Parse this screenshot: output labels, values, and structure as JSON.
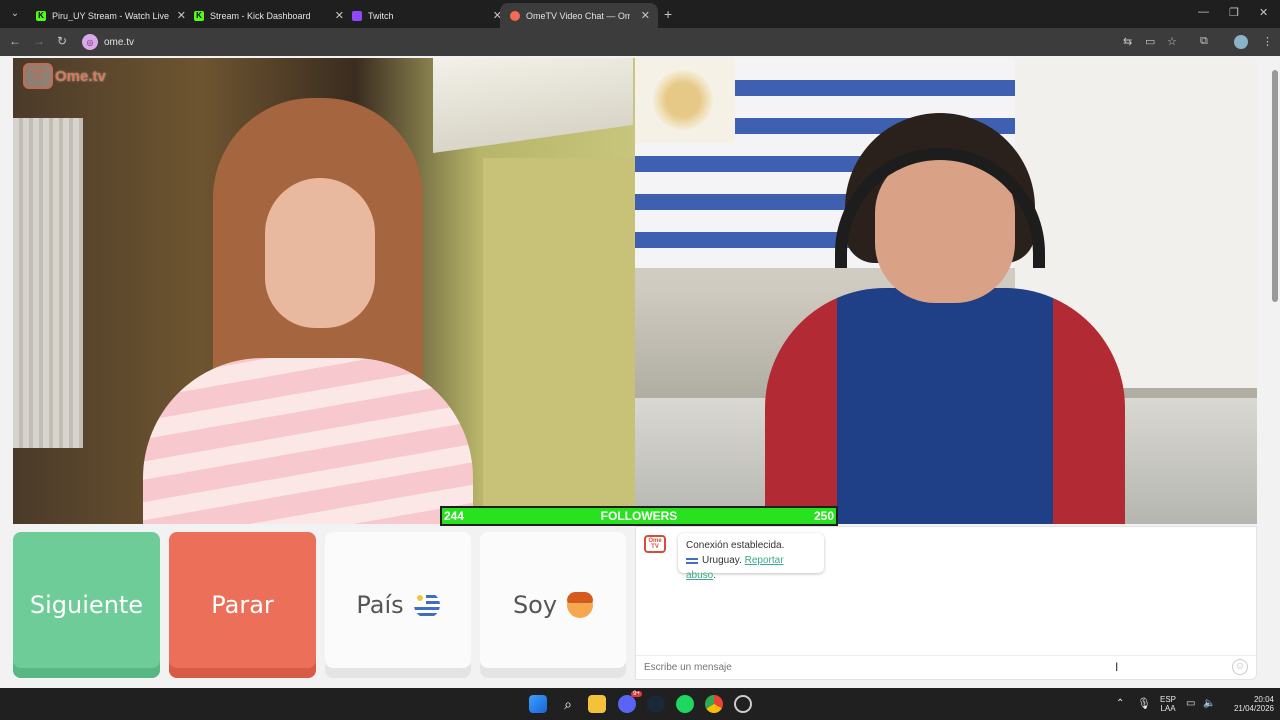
{
  "browser": {
    "tabs": [
      {
        "title": "Piru_UY Stream - Watch Live on",
        "fav_color": "#53fc18",
        "fav_text": "K"
      },
      {
        "title": "Stream - Kick Dashboard",
        "fav_color": "#53fc18",
        "fav_text": "K"
      },
      {
        "title": "Twitch",
        "fav_color": "#9146ff",
        "fav_text": ""
      },
      {
        "title": "OmeTV Video Chat — Ome",
        "fav_color": "#f26b55",
        "fav_text": ""
      }
    ],
    "url": "ome.tv"
  },
  "logo": {
    "box_top": "Ome",
    "box_bottom": "TV",
    "text": "Ome.tv"
  },
  "followers": {
    "left_count": "244",
    "label": "FOLLOWERS",
    "right_count": "250"
  },
  "controls": {
    "next_label": "Siguiente",
    "stop_label": "Parar",
    "country_label": "País",
    "gender_label": "Soy"
  },
  "chat": {
    "status": "Conexión establecida.",
    "country": "Uruguay.",
    "report_link": "Reportar abuso",
    "report_suffix": ".",
    "input_placeholder": "Escribe un mensaje"
  },
  "taskbar": {
    "lang_top": "ESP",
    "lang_bottom": "LAA",
    "time": "20:04",
    "date": "21/04/2026",
    "discord_badge": "9+"
  },
  "colors": {
    "next": "#6dcc97",
    "stop": "#ec7059",
    "followers_bar": "#29e21f",
    "link": "#3aa98c"
  }
}
